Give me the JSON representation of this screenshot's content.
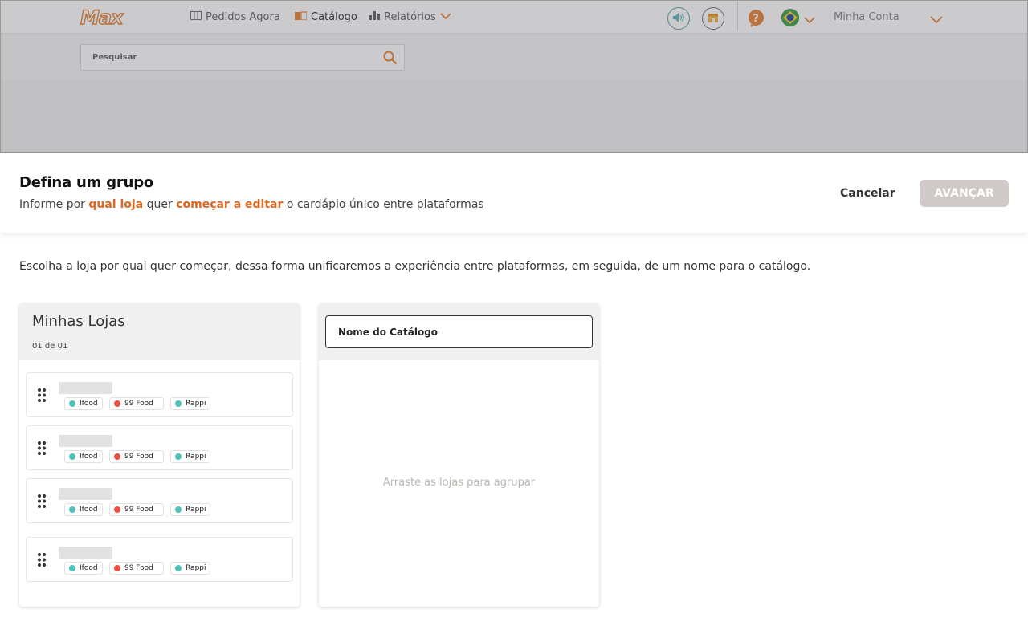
{
  "header": {
    "logo_text": "Max",
    "nav": [
      {
        "label": "Pedidos Agora",
        "icon": "columns-icon"
      },
      {
        "label": "Catálogo",
        "icon": "book-icon"
      },
      {
        "label": "Relatórios",
        "icon": "bar-chart-icon"
      }
    ],
    "account_label": "Minha Conta",
    "accent_color": "#e8843a"
  },
  "search": {
    "placeholder": "Pesquisar"
  },
  "drawer": {
    "title": "Defina um grupo",
    "subtitle_parts": [
      "Informe por ",
      "qual loja",
      " quer ",
      "começar a editar",
      " o cardápio único entre plataformas"
    ],
    "cancel_label": "Cancelar",
    "next_label": "AVANÇAR",
    "highlight_color": "#e0651e"
  },
  "instructions": "Escolha a loja por qual quer começar, dessa forma unificaremos a experiência entre plataformas, em seguida, de um nome para o catálogo.",
  "stores": {
    "title": "Minhas Lojas",
    "count": "01 de 01",
    "items": [
      {
        "platforms": [
          {
            "name": "Ifood",
            "color": "#4fc3b9"
          },
          {
            "name": "99 Food",
            "color": "#ef4d3e"
          },
          {
            "name": "Rappi",
            "color": "#4fc3b9"
          }
        ]
      },
      {
        "platforms": [
          {
            "name": "Ifood",
            "color": "#4fc3b9"
          },
          {
            "name": "99 Food",
            "color": "#ef4d3e"
          },
          {
            "name": "Rappi",
            "color": "#4fc3b9"
          }
        ]
      },
      {
        "platforms": [
          {
            "name": "Ifood",
            "color": "#4fc3b9"
          },
          {
            "name": "99 Food",
            "color": "#ef4d3e"
          },
          {
            "name": "Rappi",
            "color": "#4fc3b9"
          }
        ]
      },
      {
        "platforms": [
          {
            "name": "Ifood",
            "color": "#4fc3b9"
          },
          {
            "name": "99 Food",
            "color": "#ef4d3e"
          },
          {
            "name": "Rappi",
            "color": "#4fc3b9"
          }
        ]
      }
    ]
  },
  "catalog": {
    "name_placeholder": "Nome do Catálogo",
    "drop_hint": "Arraste as lojas para agrupar"
  }
}
